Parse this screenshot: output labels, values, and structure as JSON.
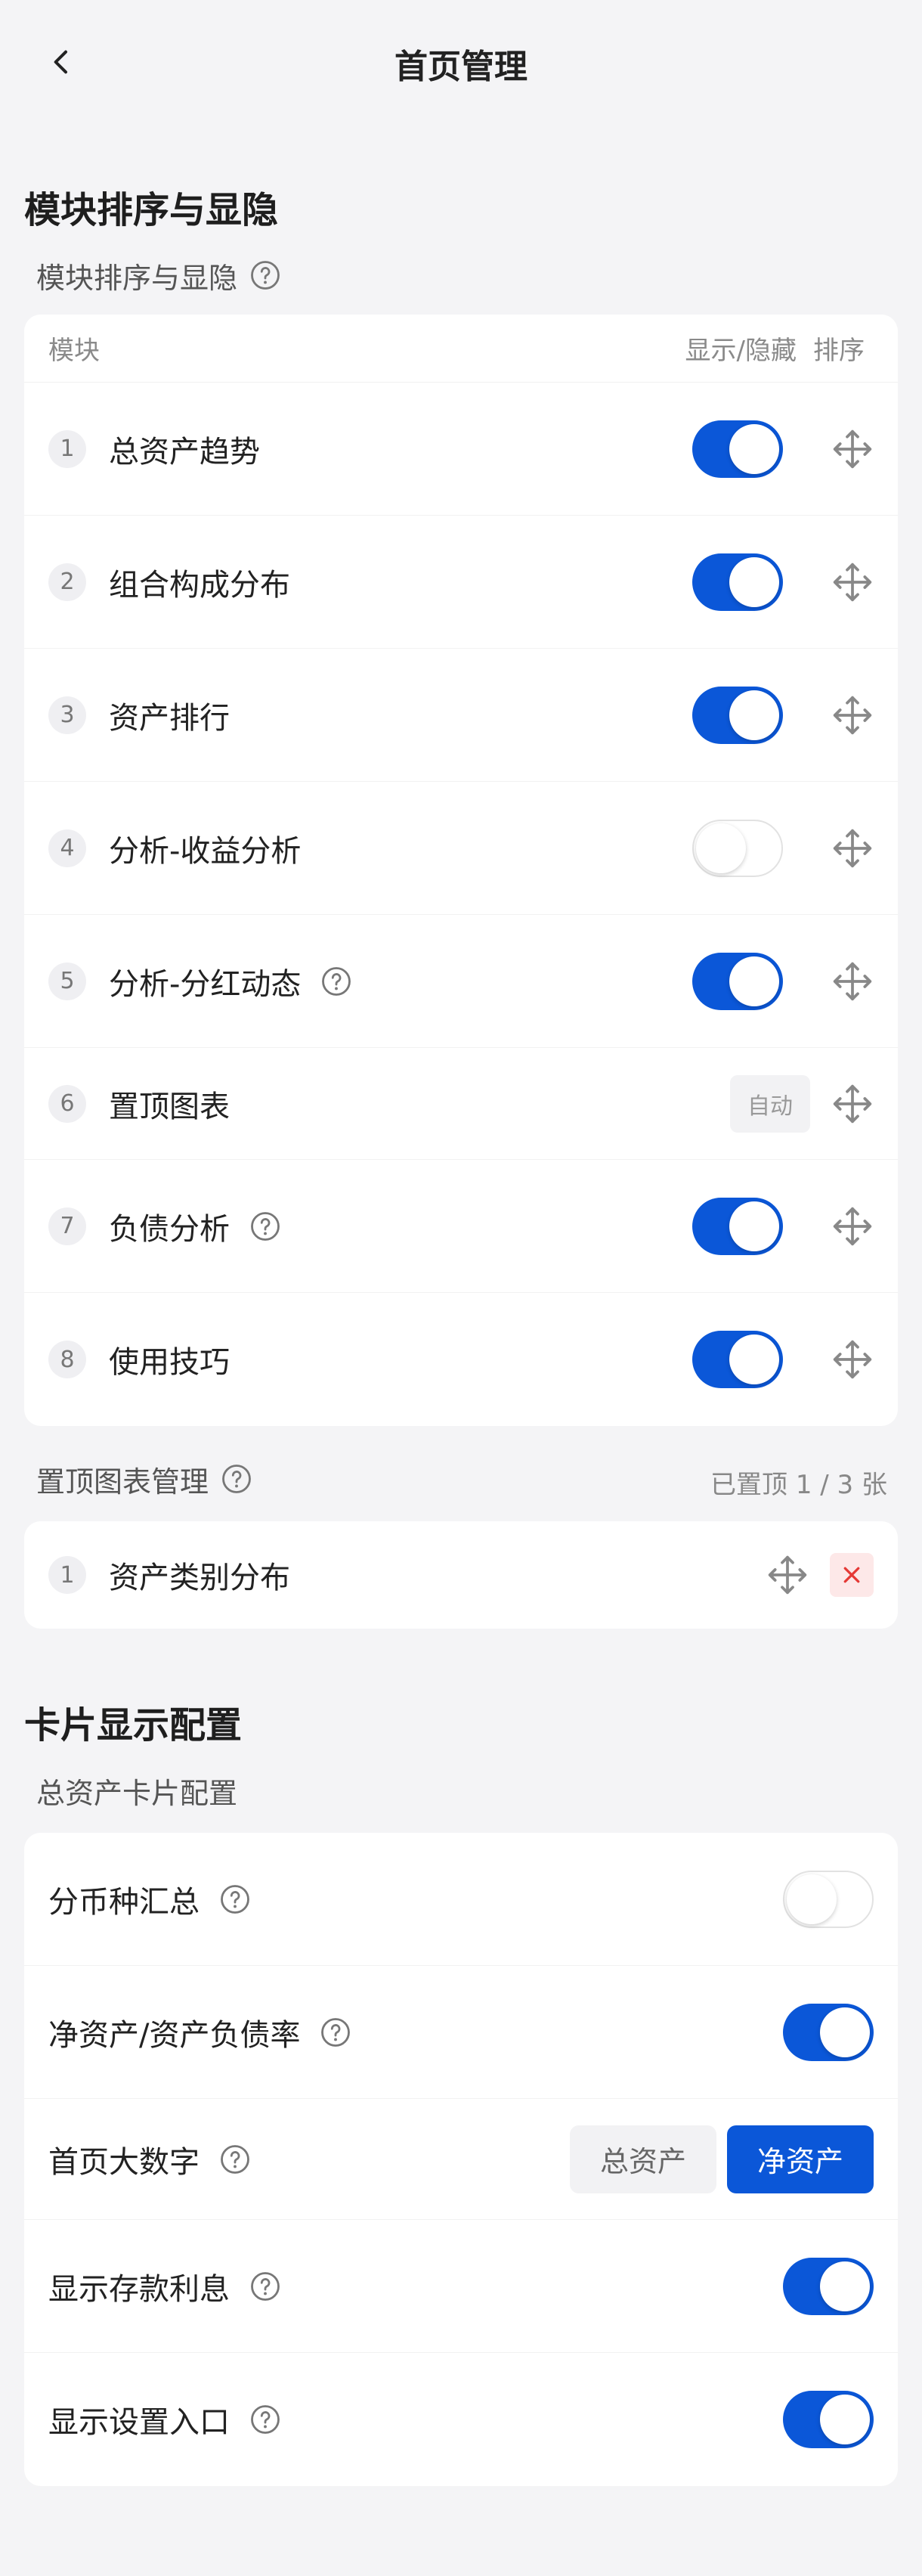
{
  "header": {
    "title": "首页管理"
  },
  "section1": {
    "title": "模块排序与显隐",
    "sub_label": "模块排序与显隐",
    "table_head": {
      "module": "模块",
      "show": "显示/隐藏",
      "sort": "排序"
    },
    "rows": [
      {
        "num": "1",
        "label": "总资产趋势",
        "state": "on"
      },
      {
        "num": "2",
        "label": "组合构成分布",
        "state": "on"
      },
      {
        "num": "3",
        "label": "资产排行",
        "state": "on"
      },
      {
        "num": "4",
        "label": "分析-收益分析",
        "state": "off"
      },
      {
        "num": "5",
        "label": "分析-分红动态",
        "state": "on"
      },
      {
        "num": "6",
        "label": "置顶图表",
        "auto": "自动"
      },
      {
        "num": "7",
        "label": "负债分析",
        "state": "on"
      },
      {
        "num": "8",
        "label": "使用技巧",
        "state": "on"
      }
    ]
  },
  "pinned": {
    "label": "置顶图表管理",
    "meta": "已置顶 1 / 3 张",
    "items": [
      {
        "num": "1",
        "label": "资产类别分布"
      }
    ]
  },
  "section2": {
    "title": "卡片显示配置",
    "sub_label": "总资产卡片配置",
    "rows": [
      {
        "label": "分币种汇总",
        "state": "off"
      },
      {
        "label": "净资产/资产负债率",
        "state": "on"
      },
      {
        "label": "首页大数字",
        "options": [
          "总资产",
          "净资产"
        ],
        "selected": "净资产"
      },
      {
        "label": "显示存款利息",
        "state": "on"
      },
      {
        "label": "显示设置入口",
        "state": "on"
      }
    ]
  },
  "colors": {
    "accent": "#0b57d8",
    "danger": "#e53935"
  },
  "icons": {
    "back": "chevron-left-icon",
    "help": "question-circle-icon",
    "move": "move-arrows-icon",
    "close": "close-icon"
  }
}
